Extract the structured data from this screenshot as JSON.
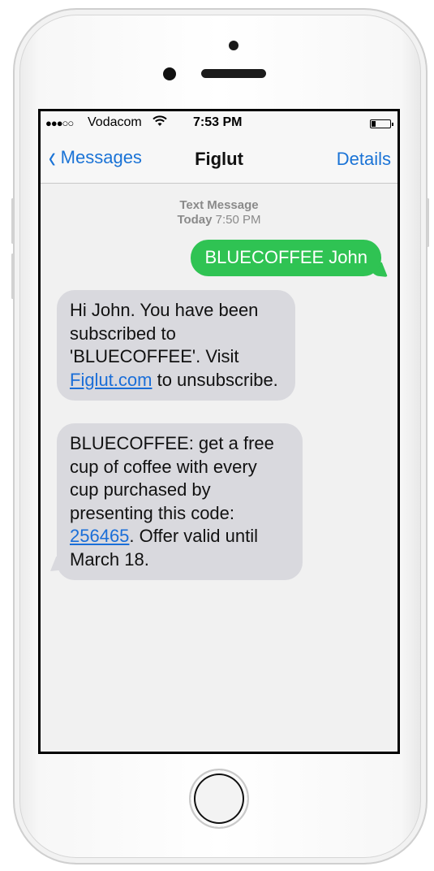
{
  "status_bar": {
    "signal": "●●●○○",
    "carrier": "Vodacom",
    "time": "7:53 PM"
  },
  "nav": {
    "back_label": "Messages",
    "title": "Figlut",
    "details_label": "Details"
  },
  "thread": {
    "type_label": "Text Message",
    "date_label": "Today",
    "time_label": "7:50 PM"
  },
  "messages": {
    "sent1": "BLUECOFFEE John",
    "recv1": {
      "before_link": "Hi John. You have been subscribed to 'BLUECOFFEE'. Visit ",
      "link": "Figlut.com",
      "after_link": " to unsubscribe."
    },
    "recv2": {
      "before_link": "BLUECOFFEE: get a free cup of coffee with every cup purchased by presenting this code: ",
      "link": "256465",
      "after_link": ". Offer valid until March 18."
    }
  },
  "colors": {
    "sent_bubble": "#2fc353",
    "received_bubble": "#d9d9de",
    "link": "#1a6ed8",
    "nav_accent": "#1a73d6"
  }
}
